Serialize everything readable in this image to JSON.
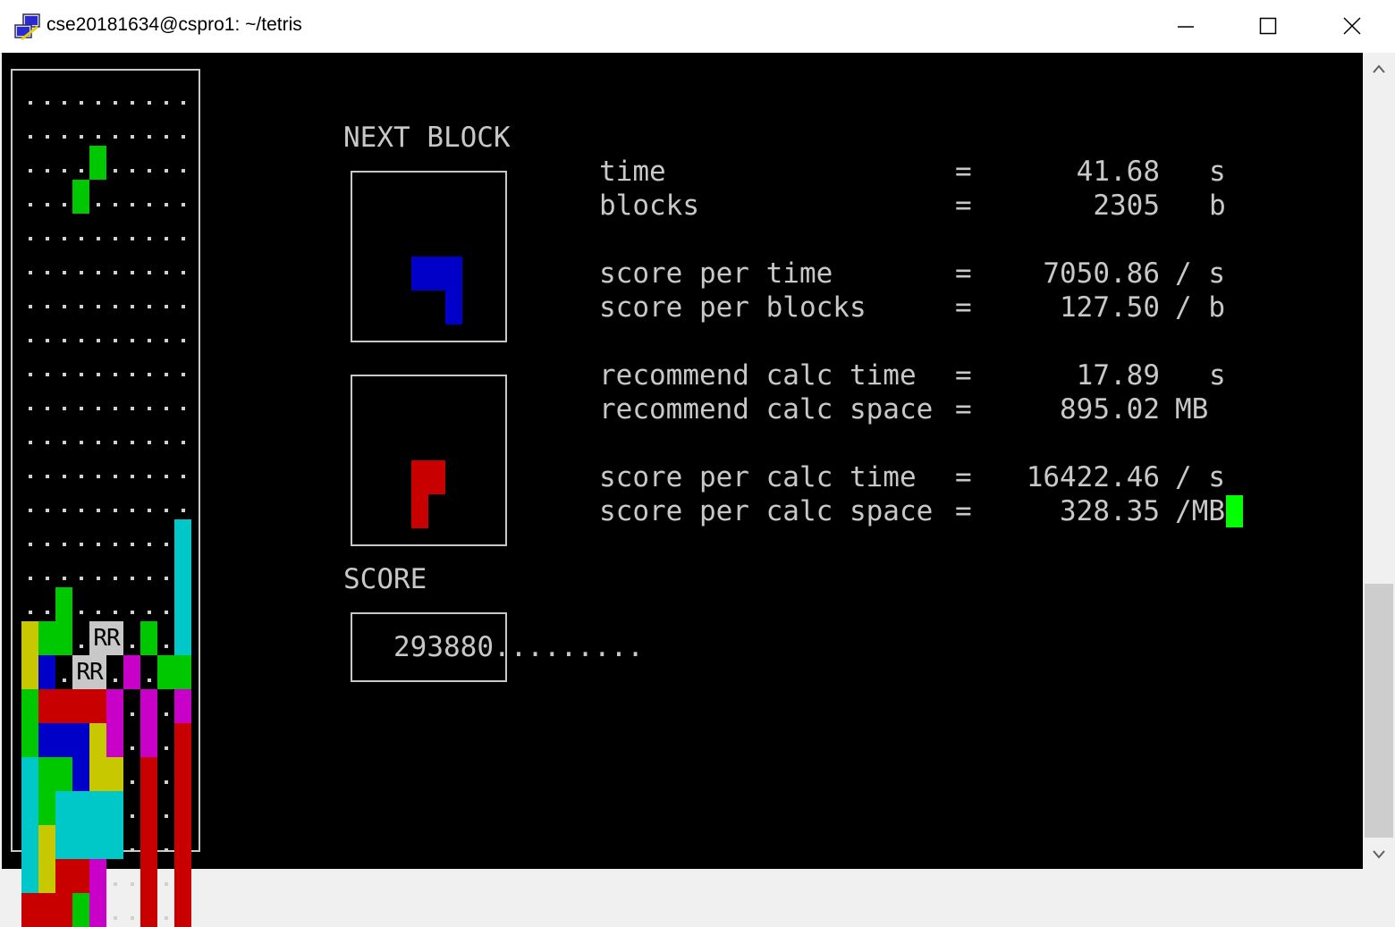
{
  "window": {
    "title": "cse20181634@cspro1: ~/tetris",
    "app_icon": "putty-icon",
    "controls": [
      "minimize-icon",
      "maximize-icon",
      "close-icon"
    ]
  },
  "labels": {
    "next_block": "NEXT BLOCK",
    "score": "SCORE"
  },
  "score": {
    "value": "293880",
    "trail": "........."
  },
  "stats": [
    {
      "label": "time",
      "eq": "=",
      "value": "41.68",
      "unit": "s"
    },
    {
      "label": "blocks",
      "eq": "=",
      "value": "2305",
      "unit": "b"
    },
    {
      "label": "score per time",
      "eq": "=",
      "value": "7050.86",
      "unit": "/ s"
    },
    {
      "label": "score per blocks",
      "eq": "=",
      "value": "127.50",
      "unit": "/ b"
    },
    {
      "label": "recommend calc time",
      "eq": "=",
      "value": "17.89",
      "unit": "s"
    },
    {
      "label": "recommend calc space",
      "eq": "=",
      "value": "895.02",
      "unit": "MB"
    },
    {
      "label": "score per calc time",
      "eq": "=",
      "value": "16422.46",
      "unit": "/ s"
    },
    {
      "label": "score per calc space",
      "eq": "=",
      "value": "328.35",
      "unit": "/MB"
    }
  ],
  "board": {
    "cols": 10,
    "rows": 22,
    "recommend_marker": "RR",
    "grid": [
      "..........",
      "..........",
      "....G.....",
      "...G......",
      "..........",
      "..........",
      "..........",
      "..........",
      "..........",
      "..........",
      "..........",
      "..........",
      "..........",
      ".........C",
      ".........C",
      "..G......C",
      "YGG.RR.G.C",
      "YB.RR.M.GG",
      "GRRRRM.M.M",
      "GBBBYM.M.R",
      "CGGBYY.R.R",
      "CGCCCC.R.R",
      "CYCCCC.R.R",
      "CYRRM..R.R",
      "RRRGM..R.R"
    ]
  },
  "next_blocks": [
    {
      "color": "blue",
      "shape": [
        "XXX",
        "..X"
      ]
    },
    {
      "color": "red",
      "shape": [
        "XX",
        "X."
      ]
    }
  ],
  "colors": {
    "background": "#000000",
    "text": "#c8c8c8",
    "G": "#00c800",
    "Y": "#c8c800",
    "B": "#0000c8",
    "R": "#c80000",
    "M": "#c800c8",
    "C": "#00c8c8",
    "cursor": "#00ff00"
  }
}
